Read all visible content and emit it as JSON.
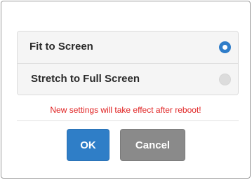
{
  "dialog": {
    "options": [
      {
        "label": "Fit to Screen",
        "selected": true
      },
      {
        "label": "Stretch to Full Screen",
        "selected": false
      }
    ],
    "notice": "New settings will take effect after reboot!",
    "buttons": {
      "ok_label": "OK",
      "cancel_label": "Cancel"
    }
  },
  "colors": {
    "accent": "#2f7dc9",
    "notice": "#e02020",
    "cancel": "#8a8a8a"
  }
}
